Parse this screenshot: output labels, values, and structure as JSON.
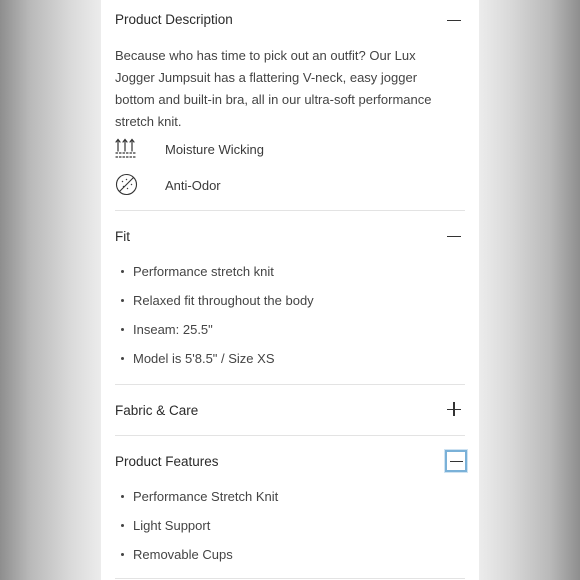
{
  "sections": {
    "description": {
      "title": "Product Description",
      "text": "Because who has time to pick out an outfit? Our Lux Jogger Jumpsuit has a flattering V-neck, easy jogger bottom and built-in bra, all in our ultra-soft performance stretch knit.",
      "toggle_icon": "minus-icon",
      "features": [
        {
          "icon": "moisture-wicking-icon",
          "label": "Moisture Wicking"
        },
        {
          "icon": "anti-odor-icon",
          "label": "Anti-Odor"
        }
      ]
    },
    "fit": {
      "title": "Fit",
      "toggle_icon": "minus-icon",
      "items": [
        "Performance stretch knit",
        "Relaxed fit throughout the body",
        "Inseam: 25.5\"",
        "Model is 5'8.5\" / Size XS"
      ]
    },
    "fabric": {
      "title": "Fabric & Care",
      "toggle_icon": "plus-icon"
    },
    "features": {
      "title": "Product Features",
      "toggle_icon": "minus-icon",
      "items": [
        "Performance Stretch Knit",
        "Light Support",
        "Removable Cups"
      ]
    }
  },
  "colors": {
    "focus_ring": "#7ab1d8",
    "divider": "#e3e3e3",
    "text": "#2b2b2b"
  }
}
